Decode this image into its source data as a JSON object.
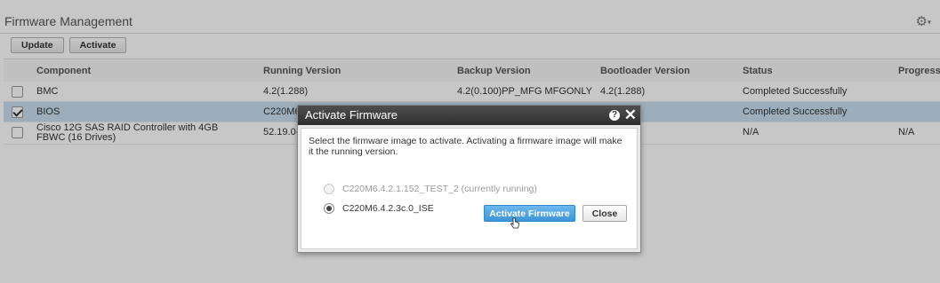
{
  "page": {
    "title": "Firmware Management"
  },
  "header": {
    "settings_icon": "gear-icon"
  },
  "toolbar": {
    "update_label": "Update",
    "activate_label": "Activate"
  },
  "table": {
    "columns": [
      "Component",
      "Running Version",
      "Backup Version",
      "Bootloader Version",
      "Status",
      "Progress i"
    ],
    "rows": [
      {
        "selected": false,
        "component": "BMC",
        "running": "4.2(1.288)",
        "backup": "4.2(0.100)PP_MFG MFGONLY",
        "bootloader": "4.2(1.288)",
        "status": "Completed Successfully",
        "progress": ""
      },
      {
        "selected": true,
        "component": "BIOS",
        "running": "C220M6",
        "backup": "",
        "bootloader": "",
        "status": "Completed Successfully",
        "progress": ""
      },
      {
        "selected": false,
        "component": "Cisco 12G SAS RAID Controller with 4GB FBWC (16 Drives)",
        "running": "52.19.0-",
        "backup": "",
        "bootloader": "",
        "status": "N/A",
        "progress": "N/A"
      }
    ]
  },
  "dialog": {
    "title": "Activate Firmware",
    "help_icon": "?",
    "close_icon": "✕",
    "message": "Select the firmware image to activate. Activating a firmware image will make it the running version.",
    "options": [
      {
        "label": "C220M6.4.2.1.152_TEST_2 (currently running)",
        "selected": false,
        "disabled": true
      },
      {
        "label": "C220M6.4.2.3c.0_ISE",
        "selected": true,
        "disabled": false
      }
    ],
    "primary_label": "Activate Firmware",
    "close_label": "Close"
  },
  "colors": {
    "accent": "#3d95d8",
    "selected_row": "#c8dff0",
    "dialog_header": "#3a3a3a"
  }
}
